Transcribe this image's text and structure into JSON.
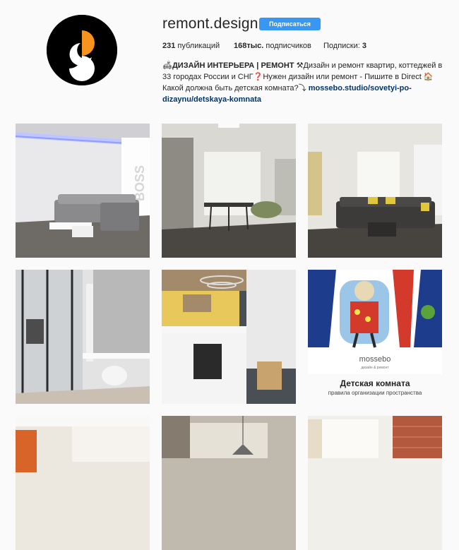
{
  "profile": {
    "username": "remont.design",
    "follow_label": "Подписаться",
    "posts_count": "231",
    "posts_label": "публикаций",
    "followers_count": "168тыс.",
    "followers_label": "подписчиков",
    "following_label": "Подписки:",
    "following_count": "3",
    "bio_title": "ДИЗАЙН ИНТЕРЬЕРА | РЕМОНТ",
    "bio_text_1": "Дизайн и ремонт квартир, коттеджей в 33 городах России и СНГ",
    "bio_text_2": "Нужен дизайн или ремонт - Пишите в Direct",
    "bio_text_3": "Какой должна быть детская комната?",
    "bio_link": "mossebo.studio/sovetyi-po-dizaynu/detskaya-komnata",
    "avatar_colors": {
      "background": "#000000",
      "accent": "#f7941d",
      "inner": "#ffffff"
    }
  },
  "accent_color": "#3897f0",
  "posts": [
    {
      "image": "living-room-grey-sofa",
      "overlay_text": "BOSS"
    },
    {
      "image": "kitchen-dining-with-bar-stools",
      "overlay_text": ""
    },
    {
      "image": "living-room-dark-sofa-yellow-pillows",
      "overlay_text": ""
    },
    {
      "image": "home-office-glass-partition",
      "overlay_text": ""
    },
    {
      "image": "kitchen-yellow-tiles",
      "overlay_text": ""
    },
    {
      "image": "kids-room-illustration",
      "brand": "mossebo",
      "brand_sub": "дизайн & ремонт",
      "title": "Детская комната",
      "subtitle": "правила организации пространства"
    },
    {
      "image": "living-room-orange-accent",
      "overlay_text": ""
    },
    {
      "image": "dining-pendant-lamp",
      "overlay_text": ""
    },
    {
      "image": "room-brick-wall",
      "overlay_text": ""
    }
  ]
}
